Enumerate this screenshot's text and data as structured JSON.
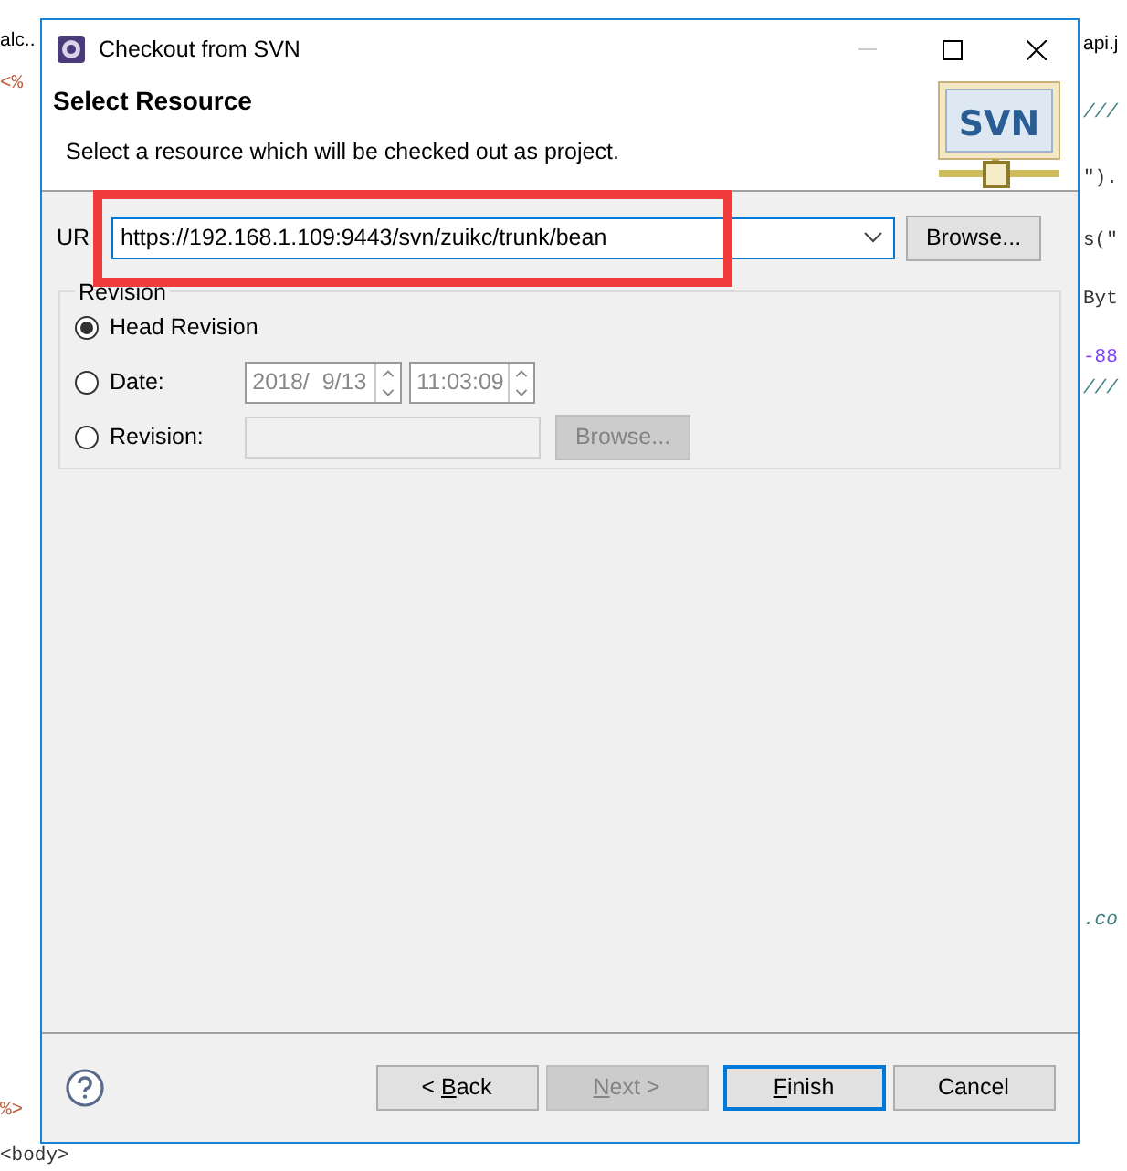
{
  "background_editor": {
    "left": [
      {
        "text": "alc..",
        "kind": "tab"
      },
      {
        "text": "<%",
        "kind": "tag"
      },
      {
        "text": "%>",
        "kind": "tag"
      },
      {
        "text": "<body>",
        "kind": "code"
      }
    ],
    "right": [
      {
        "text": "api.j",
        "kind": "tab"
      },
      {
        "text": "///",
        "kind": "comment"
      },
      {
        "text": "\").",
        "kind": "code"
      },
      {
        "text": "s(\"",
        "kind": "code"
      },
      {
        "text": "Byt",
        "kind": "code"
      },
      {
        "text": "-88",
        "kind": "number"
      },
      {
        "text": "///",
        "kind": "comment"
      },
      {
        "text": ".co",
        "kind": "comment"
      }
    ]
  },
  "window": {
    "title": "Checkout from SVN"
  },
  "header": {
    "title": "Select Resource",
    "subtitle": "Select a resource which will be checked out as project.",
    "logo": "SVN"
  },
  "url": {
    "label": "UR",
    "value": "https://192.168.1.109:9443/svn/zuikc/trunk/bean",
    "browse": "Browse..."
  },
  "revision": {
    "legend": "Revision",
    "options": [
      {
        "kind": "head",
        "label": "Head Revision",
        "selected": true
      },
      {
        "kind": "date",
        "label": "Date:",
        "selected": false,
        "date": "2018/  9/13",
        "time": "11:03:09"
      },
      {
        "kind": "number",
        "label": "Revision:",
        "selected": false,
        "browse": "Browse..."
      }
    ]
  },
  "buttons": [
    {
      "before": "< ",
      "key": "B",
      "after": "ack",
      "disabled": false,
      "default": false
    },
    {
      "key": "N",
      "after": "ext >",
      "disabled": true,
      "default": false
    },
    {
      "key": "F",
      "after": "inish",
      "disabled": false,
      "default": true
    },
    {
      "before": "Cancel",
      "disabled": false,
      "default": false
    }
  ]
}
